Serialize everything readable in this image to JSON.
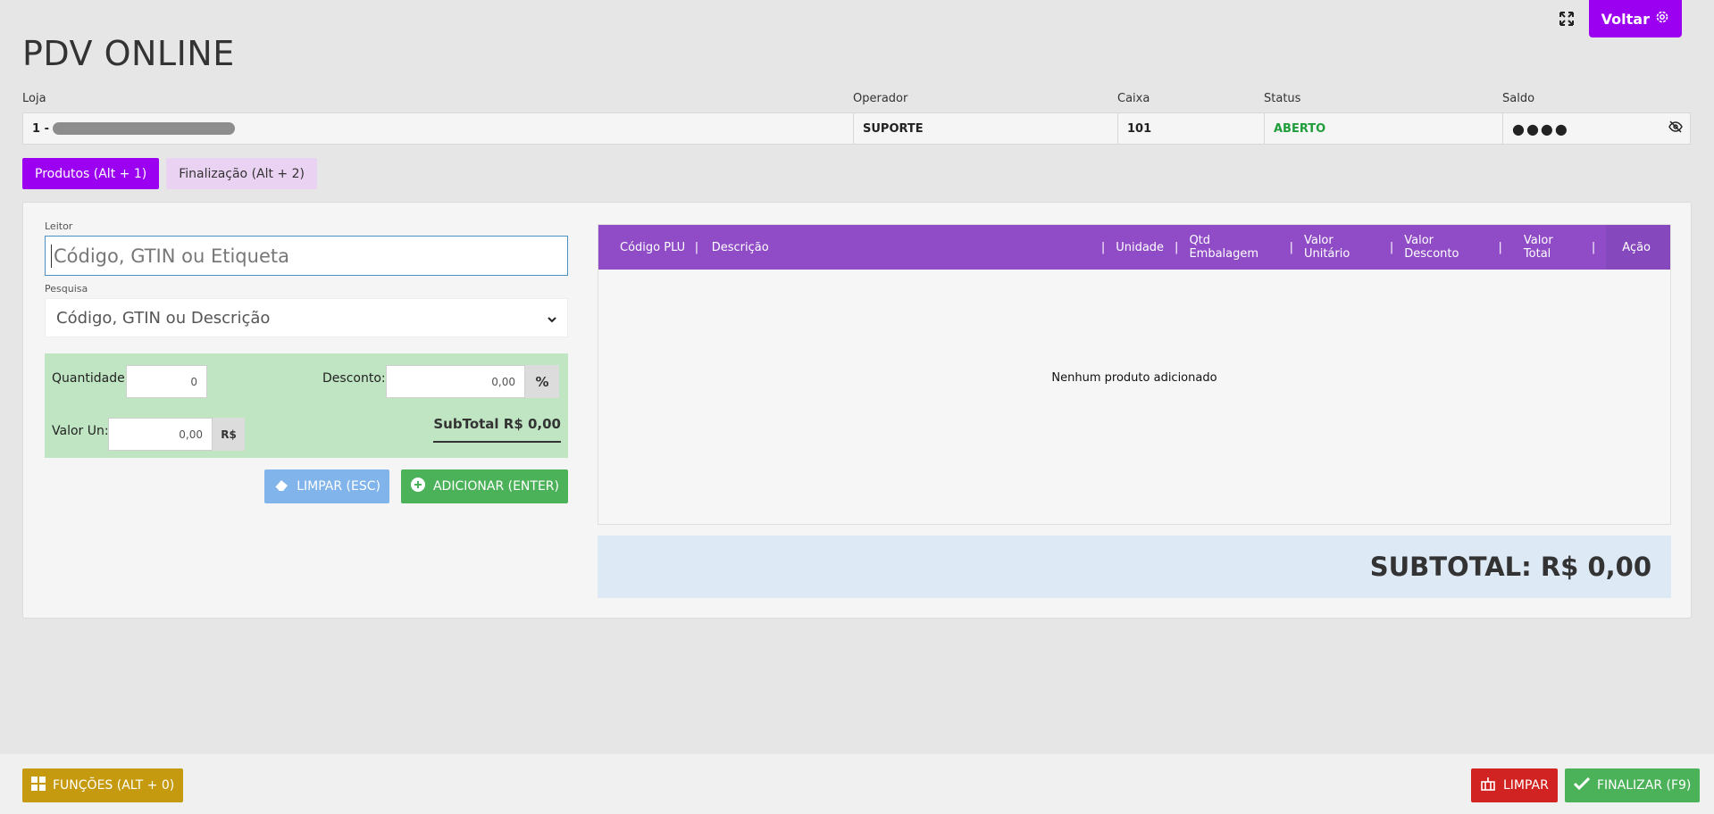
{
  "header": {
    "title": "PDV ONLINE",
    "back_label": "Voltar"
  },
  "info": {
    "columns": [
      "Loja",
      "Operador",
      "Caixa",
      "Status",
      "Saldo"
    ],
    "loja_prefix": "1 -",
    "operador": "SUPORTE",
    "caixa": "101",
    "status": "ABERTO",
    "saldo_masked": "●●●●"
  },
  "tabs": [
    {
      "label": "Produtos (Alt + 1)",
      "active": true
    },
    {
      "label": "Finalização (Alt + 2)",
      "active": false
    }
  ],
  "form": {
    "leitor_label": "Leitor",
    "leitor_placeholder": "Código, GTIN ou Etiqueta",
    "pesquisa_label": "Pesquisa",
    "pesquisa_placeholder": "Código, GTIN ou Descrição",
    "quantidade_label": "Quantidade:",
    "quantidade_value": "0",
    "desconto_label": "Desconto:",
    "desconto_value": "0,00",
    "desconto_addon": "%",
    "valor_un_label": "Valor Un:",
    "valor_un_value": "0,00",
    "valor_un_addon": "R$",
    "subtotal_small": "SubTotal R$ 0,00",
    "limpar_label": "LIMPAR (ESC)",
    "adicionar_label": "ADICIONAR (ENTER)"
  },
  "grid": {
    "columns": [
      "Código PLU",
      "Descrição",
      "Unidade",
      "Qtd Embalagem",
      "Valor Unitário",
      "Valor Desconto",
      "Valor Total",
      "Ação"
    ],
    "empty_message": "Nenhum produto adicionado"
  },
  "subtotal_big": "SUBTOTAL: R$ 0,00",
  "footer": {
    "funcoes_label": "FUNÇÕES (ALT + 0)",
    "limpar_label": "LIMPAR",
    "finalizar_label": "FINALIZAR (F9)"
  },
  "colors": {
    "accent": "#9b00f0",
    "grid_header": "#8f4cc6",
    "status_open": "#1f9d3a",
    "success": "#4cb25a",
    "danger": "#d12422",
    "warning": "#c69a0f"
  }
}
